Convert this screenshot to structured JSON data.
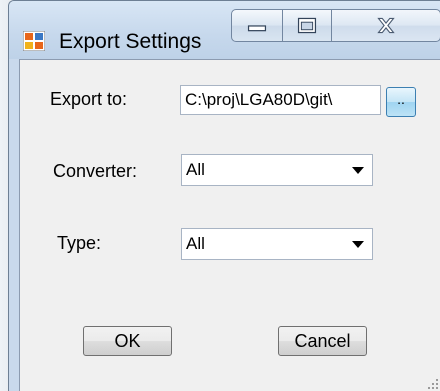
{
  "window": {
    "title": "Export Settings"
  },
  "form": {
    "export_to_label": "Export to:",
    "export_to_value": "C:\\proj\\LGA80D\\git\\",
    "browse_label": "..",
    "converter_label": "Converter:",
    "converter_value": "All",
    "type_label": "Type:",
    "type_value": "All"
  },
  "buttons": {
    "ok_label": "OK",
    "cancel_label": "Cancel"
  },
  "icons": {
    "app": "window-icon",
    "minimize": "minimize-icon",
    "maximize": "maximize-icon",
    "close": "close-icon",
    "dropdown": "chevron-down-icon",
    "resize": "resize-grip-icon"
  },
  "colors": {
    "client_bg": "#f0f0f0",
    "titlebar": "#c6d8ec",
    "browse_accent": "#9fd4f1"
  }
}
